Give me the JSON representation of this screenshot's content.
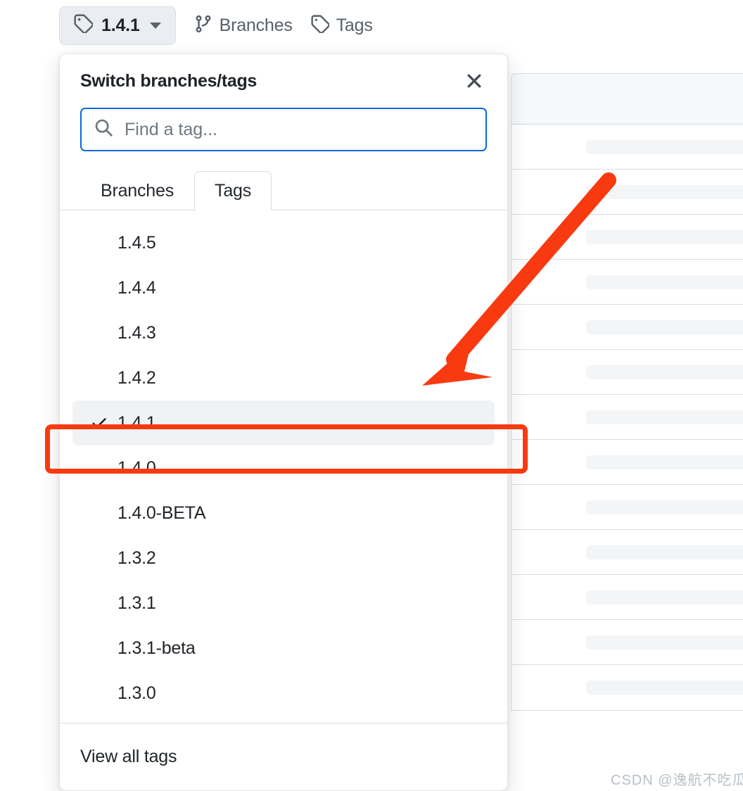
{
  "toolbar": {
    "tag_button": {
      "label": "1.4.1",
      "icon": "tag-icon",
      "caret_icon": "chevron-down-icon"
    },
    "links": [
      {
        "label": "Branches",
        "icon": "branch-icon"
      },
      {
        "label": "Tags",
        "icon": "tag-icon"
      }
    ]
  },
  "panel": {
    "title": "Switch branches/tags",
    "close_icon": "close-icon",
    "search": {
      "icon": "search-icon",
      "value": "",
      "placeholder": "Find a tag..."
    },
    "tabs": [
      {
        "label": "Branches",
        "active": false
      },
      {
        "label": "Tags",
        "active": true
      }
    ],
    "tags": [
      {
        "label": "1.4.5",
        "selected": false
      },
      {
        "label": "1.4.4",
        "selected": false
      },
      {
        "label": "1.4.3",
        "selected": false
      },
      {
        "label": "1.4.2",
        "selected": false
      },
      {
        "label": "1.4.1",
        "selected": true
      },
      {
        "label": "1.4.0",
        "selected": false
      },
      {
        "label": "1.4.0-BETA",
        "selected": false
      },
      {
        "label": "1.3.2",
        "selected": false
      },
      {
        "label": "1.3.1",
        "selected": false
      },
      {
        "label": "1.3.1-beta",
        "selected": false
      },
      {
        "label": "1.3.0",
        "selected": false
      }
    ],
    "footer": {
      "view_all_label": "View all tags"
    }
  },
  "annotations": {
    "highlight_color": "#f93a10",
    "arrow_color": "#f93a10",
    "arrow_target": "1.4.1",
    "arrow_icon": "arrow-down-left-icon"
  },
  "background": {
    "skeleton_row_count": 13,
    "header_color": "#f6f8fa",
    "skeleton_bar_color": "#f3f5f7"
  },
  "watermark": {
    "text": "CSDN @逸航不吃瓜"
  },
  "colors": {
    "accent_blue": "#0969da",
    "text_primary": "#1f2328",
    "text_muted": "#57606a",
    "selected_row": "#f0f2f4"
  }
}
